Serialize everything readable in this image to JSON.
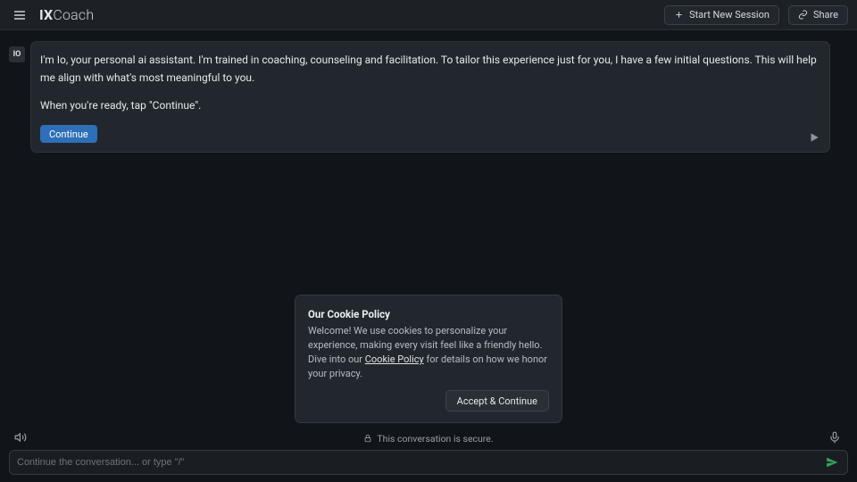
{
  "header": {
    "logo_bold": "IX",
    "logo_light": "Coach",
    "new_session_label": "Start New Session",
    "share_label": "Share"
  },
  "chat": {
    "avatar_initials": "IO",
    "paragraph1": "I'm Io, your personal ai assistant. I'm trained in coaching, counseling and facilitation. To tailor this experience just for you, I have a few initial questions. This will help me align with what's most meaningful to you.",
    "paragraph2": "When you're ready, tap \"Continue\".",
    "continue_label": "Continue"
  },
  "cookie": {
    "title": "Our Cookie Policy",
    "body_pre": "Welcome! We use cookies to personalize your experience, making every visit feel like a friendly hello. Dive into our ",
    "link_text": "Cookie Policy",
    "body_post": " for details on how we honor your privacy.",
    "accept_label": "Accept & Continue"
  },
  "footer": {
    "secure_text": "This conversation is secure.",
    "input_placeholder": "Continue the conversation... or type \"/\""
  }
}
